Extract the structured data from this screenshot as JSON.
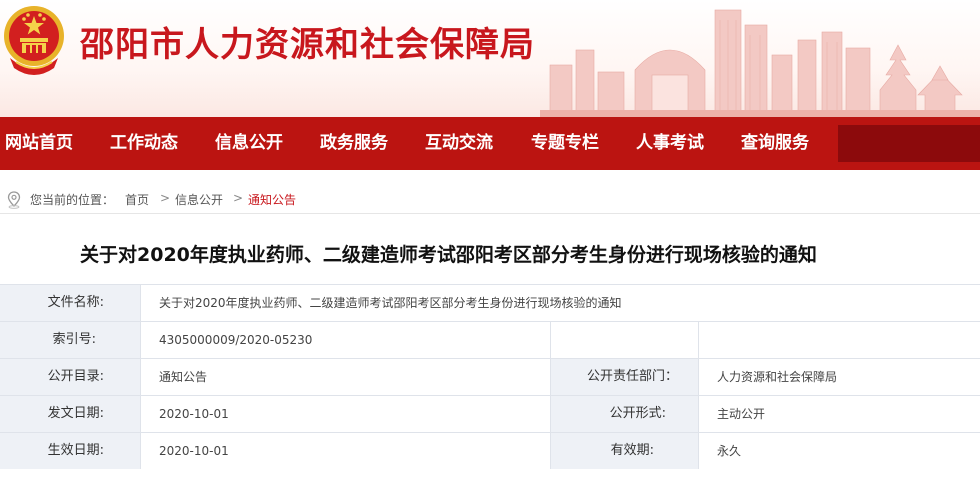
{
  "header": {
    "site_title": "邵阳市人力资源和社会保障局"
  },
  "nav": {
    "items": [
      "网站首页",
      "工作动态",
      "信息公开",
      "政务服务",
      "互动交流",
      "专题专栏",
      "人事考试",
      "查询服务"
    ]
  },
  "breadcrumb": {
    "prefix": "您当前的位置：",
    "items": [
      "首页",
      "信息公开",
      "通知公告"
    ],
    "separator": ">"
  },
  "article": {
    "title": "关于对2020年度执业药师、二级建造师考试邵阳考区部分考生身份进行现场核验的通知"
  },
  "info": {
    "file_name_label": "文件名称:",
    "file_name_value": "关于对2020年度执业药师、二级建造师考试邵阳考区部分考生身份进行现场核验的通知",
    "index_label": "索引号:",
    "index_value": "4305000009/2020-05230",
    "catalog_label": "公开目录:",
    "catalog_value": "通知公告",
    "dept_label": "公开责任部门：",
    "dept_value": "人力资源和社会保障局",
    "issue_label": "发文日期:",
    "issue_value": "2020-10-01",
    "form_label": "公开形式:",
    "form_value": "主动公开",
    "effective_label": "生效日期:",
    "effective_value": "2020-10-01",
    "validity_label": "有效期:",
    "validity_value": "永久"
  },
  "colors": {
    "brand_red": "#c8171d",
    "nav_red": "#bb1411",
    "nav_dark": "#8c0a0c",
    "label_bg": "#eef1f6"
  }
}
